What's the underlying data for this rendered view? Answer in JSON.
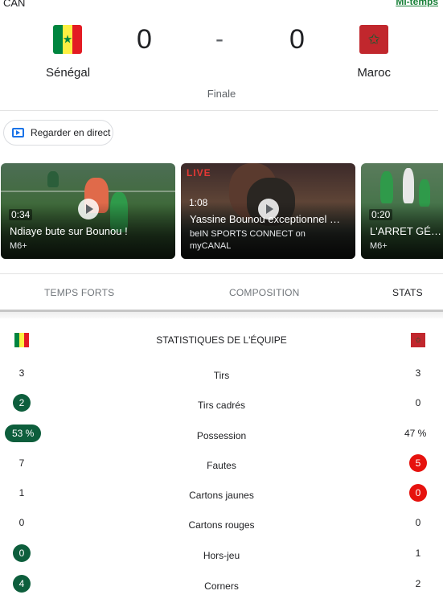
{
  "header": {
    "competition": "CAN",
    "status": "Mi-temps",
    "stage": "Finale"
  },
  "match": {
    "home": {
      "name": "Sénégal",
      "score": "0",
      "flag_icon": "senegal-flag"
    },
    "away": {
      "name": "Maroc",
      "score": "0",
      "flag_icon": "morocco-flag"
    },
    "separator": "-"
  },
  "watch_button": {
    "label": "Regarder en direct",
    "icon": "live-tv-icon"
  },
  "videos": [
    {
      "duration": "0:34",
      "title": "Ndiaye bute sur Bounou !",
      "source": "M6+",
      "live": ""
    },
    {
      "duration": "1:08",
      "title": "Yassine Bounou exceptionnel …",
      "source": "beIN SPORTS CONNECT on myCANAL",
      "live": "LIVE"
    },
    {
      "duration": "0:20",
      "title": "L'ARRET GÉNIAL",
      "source": "M6+",
      "live": ""
    }
  ],
  "tabs": [
    {
      "label": "TEMPS FORTS",
      "active": false
    },
    {
      "label": "COMPOSITION",
      "active": false
    },
    {
      "label": "STATS",
      "active": true
    }
  ],
  "team_stats": {
    "title": "STATISTIQUES DE L'ÉQUIPE",
    "rows": [
      {
        "label": "Tirs",
        "home": "3",
        "away": "3",
        "highlight": "none"
      },
      {
        "label": "Tirs cadrés",
        "home": "2",
        "away": "0",
        "highlight": "home"
      },
      {
        "label": "Possession",
        "home": "53 %",
        "away": "47 %",
        "highlight": "home"
      },
      {
        "label": "Fautes",
        "home": "7",
        "away": "5",
        "highlight": "away-red"
      },
      {
        "label": "Cartons jaunes",
        "home": "1",
        "away": "0",
        "highlight": "away-red"
      },
      {
        "label": "Cartons rouges",
        "home": "0",
        "away": "0",
        "highlight": "none"
      },
      {
        "label": "Hors-jeu",
        "home": "0",
        "away": "1",
        "highlight": "home"
      },
      {
        "label": "Corners",
        "home": "4",
        "away": "2",
        "highlight": "home"
      }
    ]
  },
  "colors": {
    "accent_green": "#0d5e3c",
    "accent_red": "#e6120e",
    "status_green": "#188038",
    "tv_blue": "#1a73e8"
  }
}
